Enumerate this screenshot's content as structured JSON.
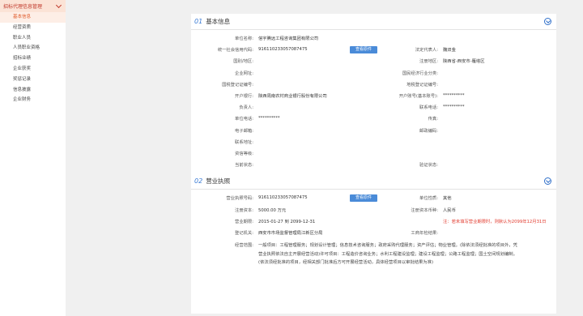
{
  "sidebar": {
    "header": "招标代理信息管理",
    "items": [
      {
        "label": "基本信息",
        "active": true
      },
      {
        "label": "经营资质",
        "active": false
      },
      {
        "label": "职业人员",
        "active": false
      },
      {
        "label": "人员职业资格",
        "active": false
      },
      {
        "label": "招标业绩",
        "active": false
      },
      {
        "label": "企业获奖",
        "active": false
      },
      {
        "label": "奖惩记录",
        "active": false
      },
      {
        "label": "信息披露",
        "active": false
      },
      {
        "label": "企业财务",
        "active": false
      }
    ]
  },
  "basic": {
    "num": "01",
    "title": "基本信息",
    "button_label": "查看原件",
    "rows": [
      {
        "l1": "单位名称:",
        "v1": "信宇腾远工程咨询集团有限公司",
        "btn": false,
        "l2": "",
        "v2": "",
        "red": false
      },
      {
        "l1": "统一社会信用代码:",
        "v1": "916110233057087475",
        "btn": true,
        "l2": "法定代表人:",
        "v2": "魏双金",
        "red": false
      },
      {
        "l1": "国别/地区:",
        "v1": "",
        "btn": false,
        "l2": "注册地区:",
        "v2": "陕西省-西安市-雁塔区",
        "red": false
      },
      {
        "l1": "企业网址:",
        "v1": "",
        "btn": false,
        "l2": "国民经济行业分类:",
        "v2": "",
        "red": false
      },
      {
        "l1": "国税登记证编号:",
        "v1": "",
        "btn": false,
        "l2": "地税登记证编号:",
        "v2": "",
        "red": false
      },
      {
        "l1": "开户银行:",
        "v1": "陕西周南农村商业银行股份有限公司",
        "btn": false,
        "l2": "开户账号(基本账号):",
        "v2": "**********",
        "red": false
      },
      {
        "l1": "负责人:",
        "v1": "",
        "btn": false,
        "l2": "联系电话:",
        "v2": "**********",
        "red": false
      },
      {
        "l1": "单位电话:",
        "v1": "**********",
        "btn": false,
        "l2": "传真:",
        "v2": "",
        "red": false
      },
      {
        "l1": "电子邮箱:",
        "v1": "",
        "btn": false,
        "l2": "邮政编码:",
        "v2": "",
        "red": false
      },
      {
        "l1": "联系地址:",
        "v1": "",
        "btn": false,
        "l2": "",
        "v2": "",
        "red": false
      },
      {
        "l1": "资信等级:",
        "v1": "",
        "btn": false,
        "l2": "",
        "v2": "",
        "red": false
      },
      {
        "l1": "当前状态:",
        "v1": "",
        "btn": false,
        "l2": "验证状态:",
        "v2": "",
        "red": false
      }
    ]
  },
  "license": {
    "num": "02",
    "title": "营业执照",
    "button_label": "查看原件",
    "rows": [
      {
        "l1": "营业执照号码:",
        "v1": "916110233057087475",
        "btn": true,
        "l2": "单位性质:",
        "v2": "其他",
        "red": false
      },
      {
        "l1": "注册资本:",
        "v1": "5000.00 万元",
        "btn": false,
        "l2": "注册资本币种:",
        "v2": "人民币",
        "red": false
      },
      {
        "l1": "营业期限:",
        "v1": "2015-01-27    到    2099-12-31",
        "btn": false,
        "l2": "",
        "v2": "注：若未填写营业期限时，则默认为2099年12月31日",
        "red": true
      },
      {
        "l1": "登记机关:",
        "v1": "西安市市场监督管理局江新区分局",
        "btn": false,
        "l2": "工商年检结果:",
        "v2": "",
        "red": false
      }
    ],
    "scope_label": "经营范围:",
    "scope_text": "一般项目：工程管理服务；规划设计管理；信息技术咨询服务；政府采购代理服务；资产评估；物业管理。(除依法须经批准的项目外，凭营业执照依法自主开展经营活动)许可项目：工程造价咨询业务；水利工程建设监理；建设工程监理；公路工程监理；国土空间规划编制。(依法须经批准的项目，经相关部门批准后方可开展经营活动，具体经营项目以审批结果为准)"
  }
}
